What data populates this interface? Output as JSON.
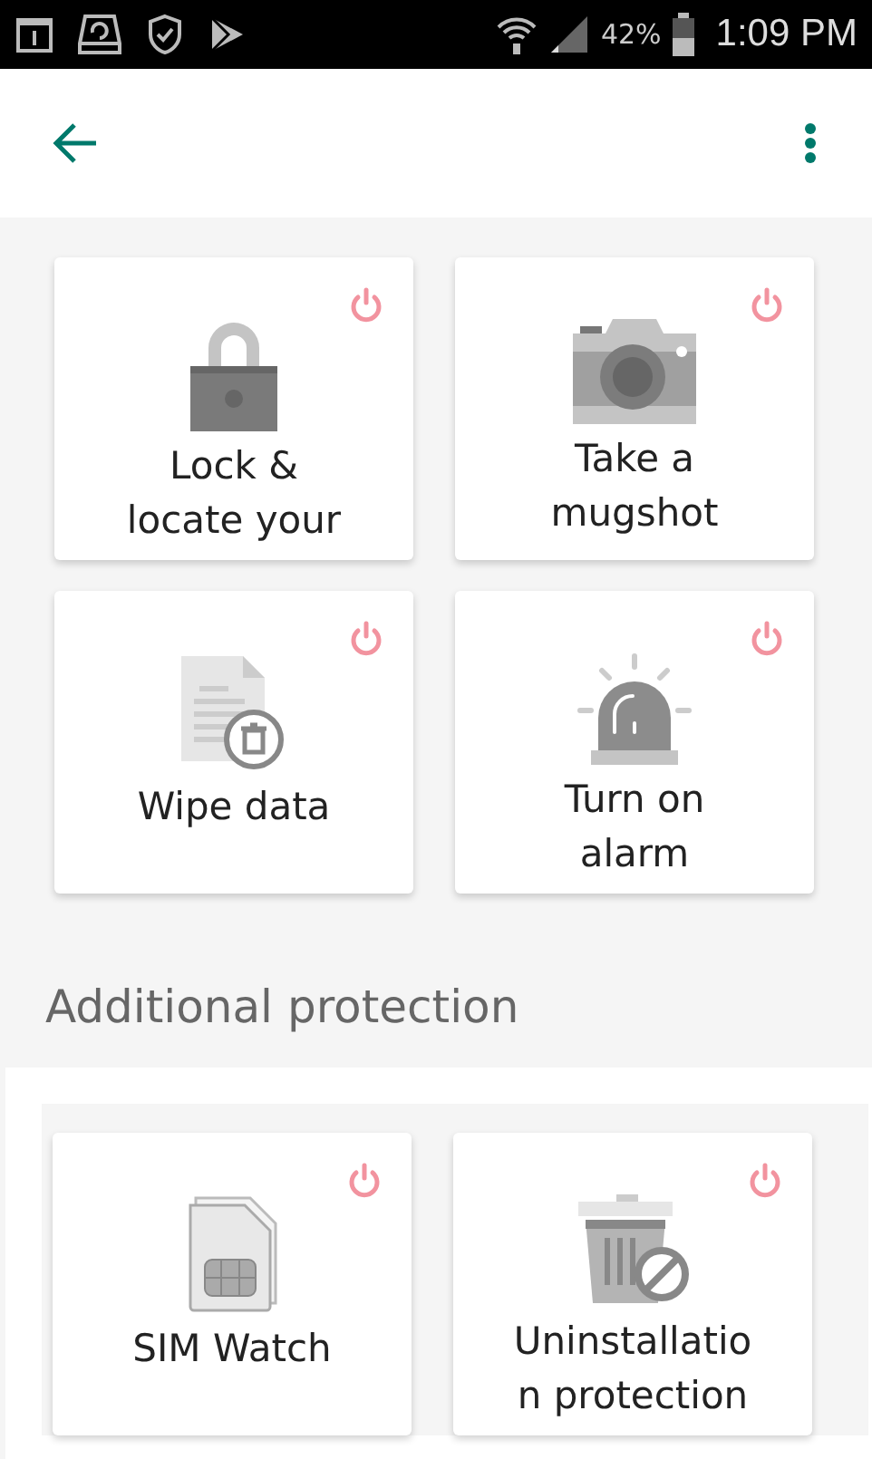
{
  "status_bar": {
    "battery": "42%",
    "time": "1:09 PM"
  },
  "cards": [
    {
      "kind": "lock",
      "lines": [
        "Lock &",
        "locate your"
      ],
      "on": false
    },
    {
      "kind": "camera",
      "lines": [
        "Take a",
        "mugshot"
      ],
      "on": false
    },
    {
      "kind": "wipe",
      "lines": [
        "Wipe data"
      ],
      "on": false
    },
    {
      "kind": "alarm",
      "lines": [
        "Turn on",
        "alarm"
      ],
      "on": false
    }
  ],
  "additional": {
    "title": "Additional protection",
    "cards": [
      {
        "kind": "sim",
        "lines": [
          "SIM Watch"
        ],
        "on": false
      },
      {
        "kind": "uninstall",
        "lines": [
          "Uninstallatio",
          "n protection"
        ],
        "on": false
      }
    ]
  }
}
